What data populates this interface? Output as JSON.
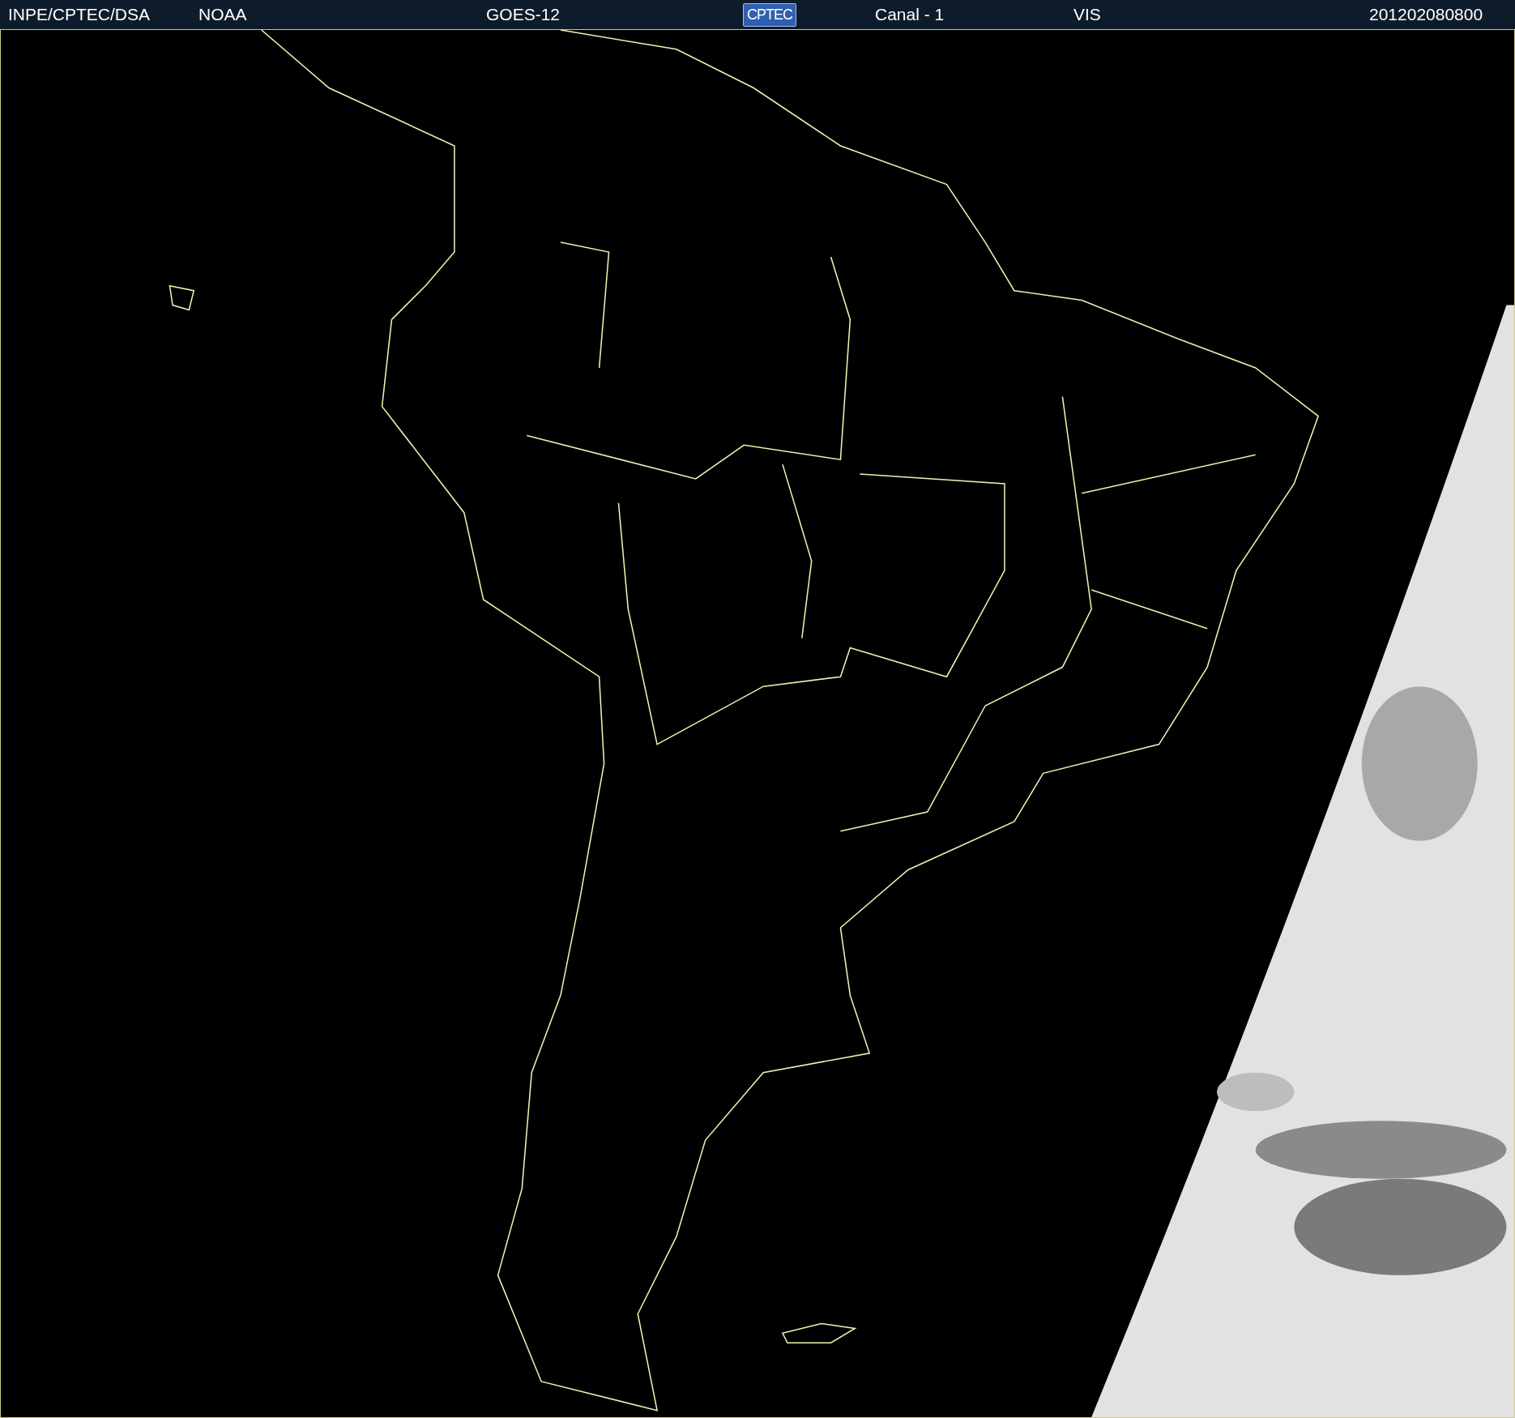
{
  "header": {
    "items": [
      {
        "kind": "text",
        "text": "INPE/CPTEC/DSA"
      },
      {
        "kind": "text",
        "text": "NOAA"
      },
      {
        "kind": "text",
        "text": "GOES-12"
      },
      {
        "kind": "logo",
        "text": "CPTEC"
      },
      {
        "kind": "text",
        "text": "Canal - 1"
      },
      {
        "kind": "text",
        "text": "VIS"
      },
      {
        "kind": "text",
        "text": "201202080800"
      }
    ]
  }
}
